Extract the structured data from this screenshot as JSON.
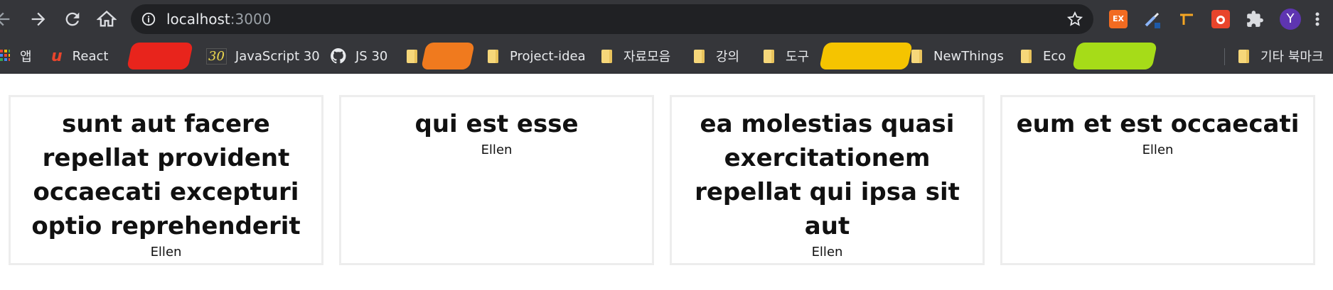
{
  "browser": {
    "url_host": "localhost",
    "url_port": ":3000",
    "profile_initial": "Y",
    "ext_badge": "EX"
  },
  "bookmarks": {
    "apps_label": "앱",
    "items": [
      {
        "label": "React"
      },
      {
        "label": "JavaScript 30"
      },
      {
        "label": "JS 30"
      },
      {
        "label": "Project-idea"
      },
      {
        "label": "자료모음"
      },
      {
        "label": "강의"
      },
      {
        "label": "도구"
      },
      {
        "label": "NewThings"
      },
      {
        "label": "Eco"
      }
    ],
    "other_label": "기타 북마크"
  },
  "colors": {
    "accent_red": "#e8241c",
    "accent_orange": "#f07a1e",
    "accent_yellow": "#f5c400",
    "accent_lime": "#a6dc18",
    "profile_purple": "#5e35b1"
  },
  "posts": [
    {
      "title": "sunt aut facere repellat provident occaecati excepturi optio reprehenderit",
      "author": "Ellen"
    },
    {
      "title": "qui est esse",
      "author": "Ellen"
    },
    {
      "title": "ea molestias quasi exercitationem repellat qui ipsa sit aut",
      "author": "Ellen"
    },
    {
      "title": "eum et est occaecati",
      "author": "Ellen"
    }
  ]
}
